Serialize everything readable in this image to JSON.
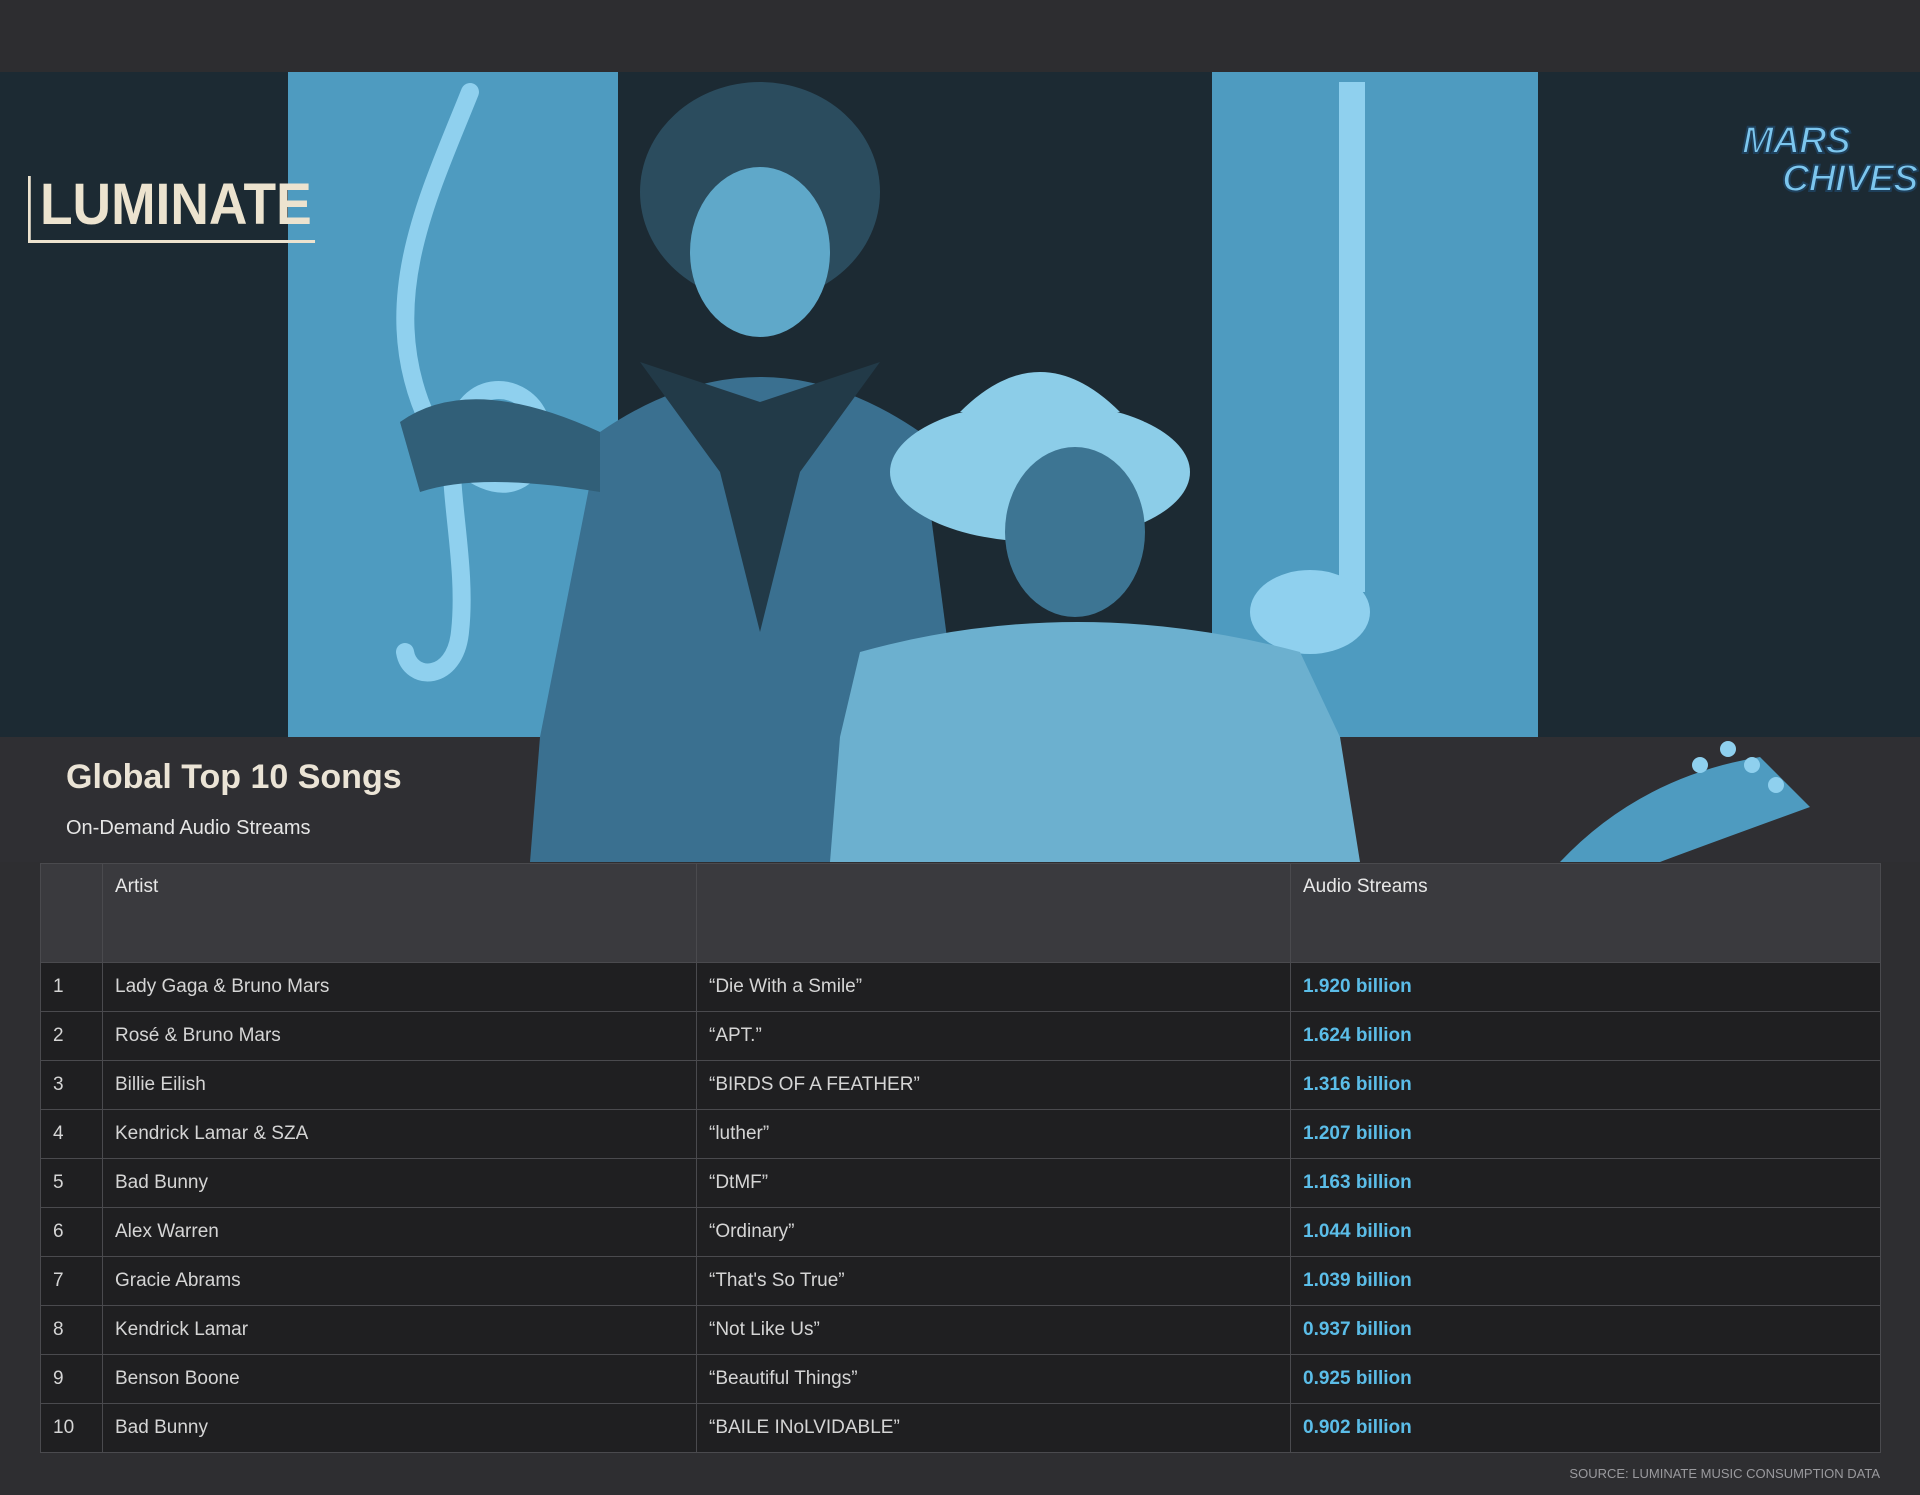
{
  "logos": {
    "left": "LUMINATE",
    "right_line1": "MARS",
    "right_line2": "CHIVES"
  },
  "header": {
    "title": "Global Top 10 Songs",
    "subtitle": "On-Demand Audio Streams"
  },
  "colors": {
    "accent": "#5bbde8",
    "background": "#2e2e31",
    "hero_tint": "#4e9bc0"
  },
  "chart_data": {
    "type": "table",
    "title": "Global Top 10 Songs",
    "subtitle": "On-Demand Audio Streams",
    "columns": [
      "",
      "Artist",
      "",
      "Audio Streams"
    ],
    "rows": [
      {
        "rank": "1",
        "artist": "Lady Gaga & Bruno Mars",
        "song": "“Die With a Smile”",
        "streams": "1.920 billion"
      },
      {
        "rank": "2",
        "artist": "Rosé & Bruno Mars",
        "song": "“APT.”",
        "streams": "1.624 billion"
      },
      {
        "rank": "3",
        "artist": "Billie Eilish",
        "song": "“BIRDS OF A FEATHER”",
        "streams": "1.316 billion"
      },
      {
        "rank": "4",
        "artist": "Kendrick Lamar & SZA",
        "song": "“luther”",
        "streams": "1.207 billion"
      },
      {
        "rank": "5",
        "artist": "Bad Bunny",
        "song": "“DtMF”",
        "streams": "1.163 billion"
      },
      {
        "rank": "6",
        "artist": "Alex Warren",
        "song": "“Ordinary”",
        "streams": "1.044 billion"
      },
      {
        "rank": "7",
        "artist": "Gracie Abrams",
        "song": "“That's So True”",
        "streams": "1.039 billion"
      },
      {
        "rank": "8",
        "artist": "Kendrick Lamar",
        "song": "“Not Like Us”",
        "streams": "0.937 billion"
      },
      {
        "rank": "9",
        "artist": "Benson Boone",
        "song": "“Beautiful Things”",
        "streams": "0.925 billion"
      },
      {
        "rank": "10",
        "artist": "Bad Bunny",
        "song": "“BAILE INoLVIDABLE”",
        "streams": "0.902 billion"
      }
    ],
    "values": [
      1.92,
      1.624,
      1.316,
      1.207,
      1.163,
      1.044,
      1.039,
      0.937,
      0.925,
      0.902
    ]
  },
  "footer": {
    "source": "SOURCE: LUMINATE MUSIC CONSUMPTION DATA"
  }
}
